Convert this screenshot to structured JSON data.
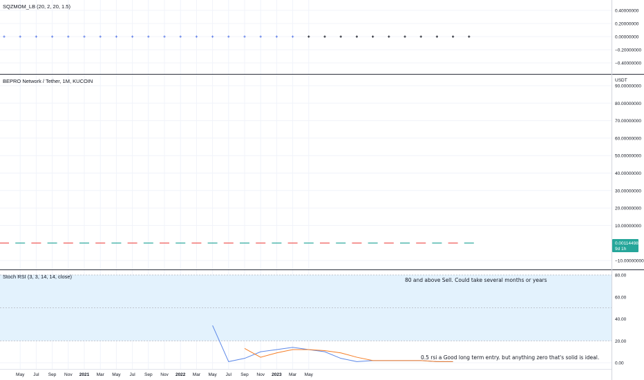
{
  "chart_data": [
    {
      "type": "scatter",
      "title": "SQZMOM_LB (20, 2, 20, 1.5)",
      "ylim": [
        -0.5,
        0.5
      ],
      "y_ticks": [
        "0.40000000",
        "0.20000000",
        "0.00000000",
        "−0.20000000",
        "−0.40000000"
      ],
      "y_tick_values": [
        0.4,
        0.2,
        0.0,
        -0.2,
        -0.4
      ],
      "series": [
        {
          "values": [
            0,
            0,
            0,
            0,
            0,
            0,
            0,
            0,
            0,
            0,
            0,
            0,
            0,
            0,
            0,
            0,
            0,
            0,
            0,
            0,
            0,
            0,
            0,
            0,
            0,
            0,
            0,
            0,
            0,
            0
          ],
          "point_colors": [
            "#5b7be8",
            "#5b7be8",
            "#5b7be8",
            "#5b7be8",
            "#5b7be8",
            "#5b7be8",
            "#5b7be8",
            "#5b7be8",
            "#5b7be8",
            "#5b7be8",
            "#5b7be8",
            "#5b7be8",
            "#5b7be8",
            "#5b7be8",
            "#5b7be8",
            "#5b7be8",
            "#5b7be8",
            "#5b7be8",
            "#5b7be8",
            "#131722",
            "#131722",
            "#131722",
            "#131722",
            "#131722",
            "#131722",
            "#131722",
            "#131722",
            "#131722",
            "#131722",
            "#131722"
          ]
        }
      ]
    },
    {
      "type": "line",
      "title": "BEPRO Network / Tether, 1M, KUCOIN",
      "unit_label": "USDT",
      "ylim": [
        -15,
        95
      ],
      "y_ticks": [
        "90.00000000",
        "80.00000000",
        "70.00000000",
        "60.00000000",
        "50.00000000",
        "40.00000000",
        "30.00000000",
        "20.00000000",
        "10.00000000",
        "−10.00000000"
      ],
      "y_tick_values": [
        90,
        80,
        70,
        60,
        50,
        40,
        30,
        20,
        10,
        -10
      ],
      "last_price_label": "0.00114498",
      "last_price_sublabel": "9d 1h",
      "series": [
        {
          "values": [
            0.0011,
            0.0011,
            0.0011,
            0.0011,
            0.0011,
            0.0011,
            0.0011,
            0.0011,
            0.0011,
            0.0011,
            0.0011,
            0.0011,
            0.0011,
            0.0011,
            0.0011,
            0.0011,
            0.0011,
            0.0011,
            0.0011,
            0.0011,
            0.0011,
            0.0011,
            0.0011,
            0.0011,
            0.0011,
            0.0011,
            0.0011,
            0.0011,
            0.0011,
            0.0011
          ]
        }
      ],
      "colors": {
        "up": "#26a69a",
        "down": "#ef5350",
        "price_tag": "#26a69a"
      }
    },
    {
      "type": "line",
      "title": "Stoch RSI (3, 3, 14, 14, close)",
      "ylim": [
        -5,
        85
      ],
      "y_ticks": [
        "80.00",
        "60.00",
        "40.00",
        "20.00",
        "0.00"
      ],
      "y_tick_values": [
        80,
        60,
        40,
        20,
        0
      ],
      "band": [
        20,
        80
      ],
      "band_lines": [
        80,
        50,
        20
      ],
      "series": [
        {
          "color": "#5b87e8",
          "x_start_index": 13,
          "values": [
            34,
            1,
            4,
            10,
            12,
            14,
            12,
            10,
            4,
            1,
            2,
            2,
            2,
            2,
            1,
            1
          ]
        },
        {
          "color": "#f57c24",
          "x_start_index": 15,
          "values": [
            13,
            5,
            9,
            12,
            12,
            11,
            9,
            5,
            2,
            2,
            2,
            2,
            1,
            1
          ]
        }
      ],
      "annotations": [
        {
          "text": "80 and above Sell. Could take several months or years"
        },
        {
          "text": "0.5 rsi a Good long term entry. but anything zero that's solid is ideal."
        }
      ]
    }
  ],
  "x_axis": {
    "ticks": [
      "May",
      "Jul",
      "Sep",
      "Nov",
      "2021",
      "Mar",
      "May",
      "Jul",
      "Sep",
      "Nov",
      "2022",
      "Mar",
      "May",
      "Jul",
      "Sep",
      "Nov",
      "2023",
      "Mar",
      "May"
    ],
    "bold_ticks": [
      "2021",
      "2022",
      "2023"
    ]
  },
  "colors": {
    "panel_separator": "#2a2e39",
    "grid": "#f0f3fa",
    "band_fill": "#e3f2fd",
    "band_line": "#b2b5be"
  }
}
